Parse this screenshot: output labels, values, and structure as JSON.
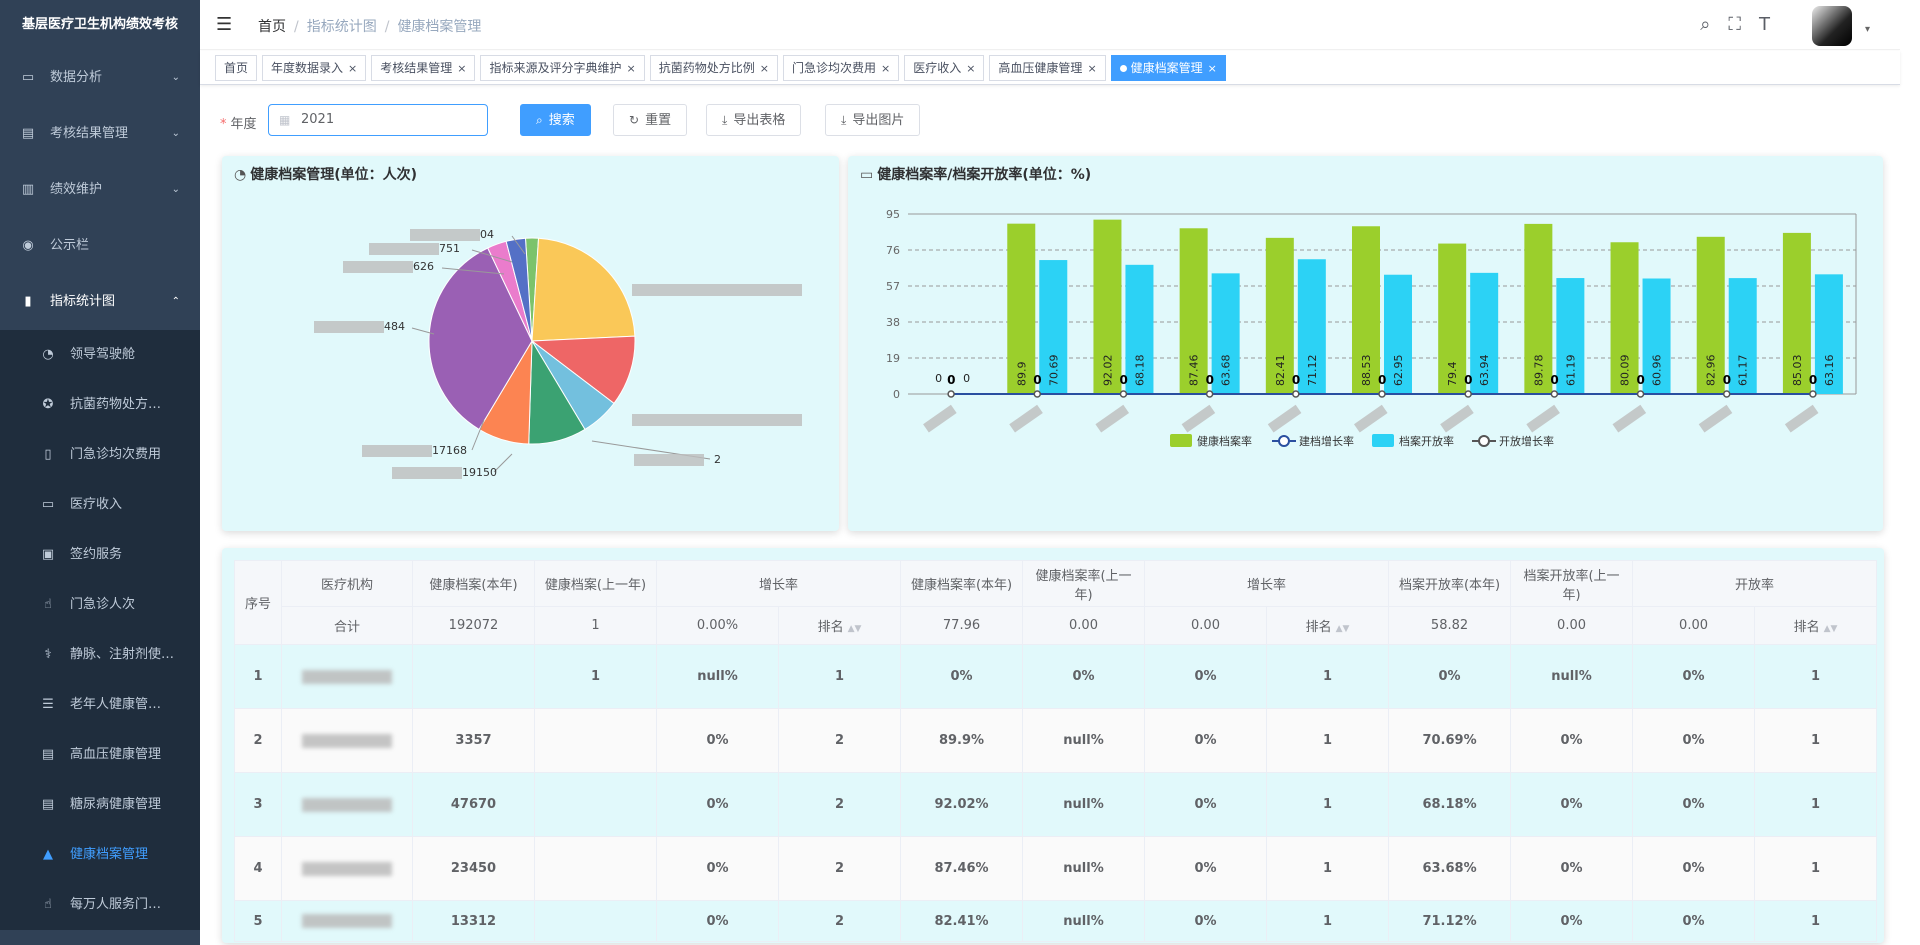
{
  "sidebar": {
    "title": "基层医疗卫生机构绩效考核",
    "items": [
      {
        "label": "数据分析",
        "icon": "monitor-icon"
      },
      {
        "label": "考核结果管理",
        "icon": "document-icon"
      },
      {
        "label": "绩效维护",
        "icon": "chart-doc-icon"
      },
      {
        "label": "公示栏",
        "icon": "eye-icon"
      },
      {
        "label": "指标统计图",
        "icon": "bar-chart-icon"
      }
    ],
    "sub_items": [
      {
        "label": "领导驾驶舱",
        "icon": "dashboard-icon"
      },
      {
        "label": "抗菌药物处方…",
        "icon": "gear-icon"
      },
      {
        "label": "门急诊均次费用",
        "icon": "book-icon"
      },
      {
        "label": "医疗收入",
        "icon": "monitor-icon"
      },
      {
        "label": "签约服务",
        "icon": "card-icon"
      },
      {
        "label": "门急诊人次",
        "icon": "hand-icon"
      },
      {
        "label": "静脉、注射剂使…",
        "icon": "syringe-icon"
      },
      {
        "label": "老年人健康管…",
        "icon": "list-icon"
      },
      {
        "label": "高血压健康管理",
        "icon": "doc-icon"
      },
      {
        "label": "糖尿病健康管理",
        "icon": "doc-icon"
      },
      {
        "label": "健康档案管理",
        "icon": "lock-icon",
        "active": true
      },
      {
        "label": "每万人服务门…",
        "icon": "hand-icon"
      }
    ]
  },
  "breadcrumb": [
    "首页",
    "指标统计图",
    "健康档案管理"
  ],
  "tags": [
    "首页",
    "年度数据录入",
    "考核结果管理",
    "指标来源及评分字典维护",
    "抗菌药物处方比例",
    "门急诊均次费用",
    "医疗收入",
    "高血压健康管理",
    "健康档案管理"
  ],
  "form": {
    "label": "年度",
    "year": "2021",
    "search": "搜索",
    "reset": "重置",
    "export_table": "导出表格",
    "export_image": "导出图片"
  },
  "pie_card": {
    "title": "健康档案管理(单位：人次)",
    "labels": [
      "04",
      "751",
      "626",
      "484",
      "17168",
      "19150",
      "2"
    ]
  },
  "bar_card": {
    "title": "健康档案率/档案开放率(单位：%)"
  },
  "chart_data": {
    "type": "bar",
    "categories": [
      "",
      "",
      "",
      "",
      "",
      "",
      "",
      "",
      "",
      "",
      ""
    ],
    "ylim": [
      0,
      95
    ],
    "yticks": [
      0,
      19,
      38,
      57,
      76,
      95
    ],
    "grid": true,
    "legend_position": "bottom",
    "series": [
      {
        "name": "健康档案率",
        "type": "bar",
        "color": "#9bcf2c",
        "values": [
          0,
          89.9,
          92.02,
          87.46,
          82.41,
          88.53,
          79.4,
          89.78,
          80.09,
          82.96,
          85.03
        ]
      },
      {
        "name": "建档增长率",
        "type": "line",
        "color": "#2a4fa0",
        "values": [
          0,
          0,
          0,
          0,
          0,
          0,
          0,
          0,
          0,
          0,
          0
        ]
      },
      {
        "name": "档案开放率",
        "type": "bar",
        "color": "#2cd2f5",
        "values": [
          0,
          70.69,
          68.18,
          63.68,
          71.12,
          62.95,
          63.94,
          61.19,
          60.96,
          61.17,
          63.16
        ]
      },
      {
        "name": "开放增长率",
        "type": "line",
        "color": "#555",
        "values": [
          0,
          0,
          0,
          0,
          0,
          0,
          0,
          0,
          0,
          0,
          0
        ]
      }
    ]
  },
  "table": {
    "h": {
      "idx": "序号",
      "org": "医疗机构",
      "cur": "健康档案(本年)",
      "prev": "健康档案(上一年)",
      "growth": "增长率",
      "rate_cur": "健康档案率(本年)",
      "rate_prev": "健康档案率(上一年)",
      "growth2": "增长率",
      "open_cur": "档案开放率(本年)",
      "open_prev": "档案开放率(上一年)",
      "open": "开放率",
      "rank": "排名"
    },
    "sum": {
      "label": "合计",
      "cur": "192072",
      "prev": "1",
      "growth": "0.00%",
      "rate_cur": "77.96",
      "rate_prev": "0.00",
      "g2": "0.00",
      "open_cur": "58.82",
      "open_prev": "0.00",
      "open": "0.00"
    },
    "rows": [
      {
        "idx": "1",
        "cur": "",
        "prev": "1",
        "growth": "null%",
        "rank1": "1",
        "rate_cur": "0%",
        "rate_prev": "0%",
        "g2": "0%",
        "rank2": "1",
        "open_cur": "0%",
        "open_prev": "null%",
        "open": "0%",
        "rank3": "1"
      },
      {
        "idx": "2",
        "cur": "3357",
        "prev": "",
        "growth": "0%",
        "rank1": "2",
        "rate_cur": "89.9%",
        "rate_prev": "null%",
        "g2": "0%",
        "rank2": "1",
        "open_cur": "70.69%",
        "open_prev": "0%",
        "open": "0%",
        "rank3": "1"
      },
      {
        "idx": "3",
        "cur": "47670",
        "prev": "",
        "growth": "0%",
        "rank1": "2",
        "rate_cur": "92.02%",
        "rate_prev": "null%",
        "g2": "0%",
        "rank2": "1",
        "open_cur": "68.18%",
        "open_prev": "0%",
        "open": "0%",
        "rank3": "1"
      },
      {
        "idx": "4",
        "cur": "23450",
        "prev": "",
        "growth": "0%",
        "rank1": "2",
        "rate_cur": "87.46%",
        "rate_prev": "null%",
        "g2": "0%",
        "rank2": "1",
        "open_cur": "63.68%",
        "open_prev": "0%",
        "open": "0%",
        "rank3": "1"
      },
      {
        "idx": "5",
        "cur": "13312",
        "prev": "",
        "growth": "0%",
        "rank1": "2",
        "rate_cur": "82.41%",
        "rate_prev": "null%",
        "g2": "0%",
        "rank2": "1",
        "open_cur": "71.12%",
        "open_prev": "0%",
        "open": "0%",
        "rank3": "1"
      }
    ]
  }
}
